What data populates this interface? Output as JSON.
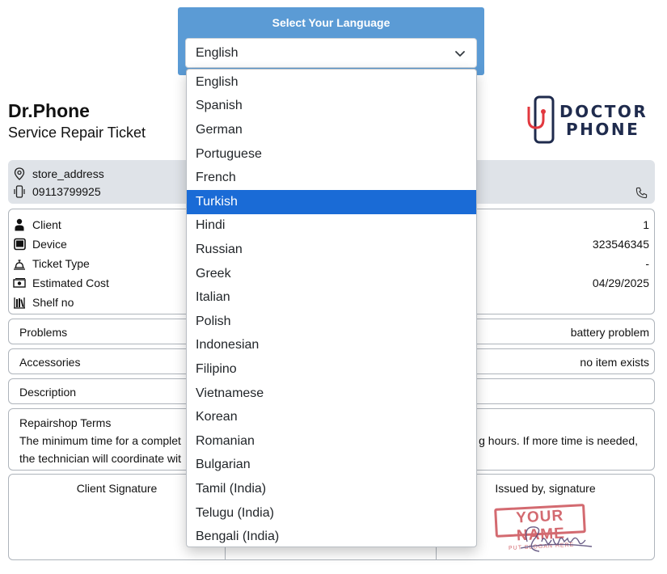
{
  "language": {
    "title": "Select Your Language",
    "selected": "English",
    "options": [
      "English",
      "Spanish",
      "German",
      "Portuguese",
      "French",
      "Turkish",
      "Hindi",
      "Russian",
      "Greek",
      "Italian",
      "Polish",
      "Indonesian",
      "Filipino",
      "Vietnamese",
      "Korean",
      "Romanian",
      "Bulgarian",
      "Tamil (India)",
      "Telugu (India)",
      "Bengali (India)"
    ],
    "highlighted": "Turkish"
  },
  "company": {
    "name": "Dr.Phone",
    "subtitle": "Service Repair Ticket",
    "logo_line1": "DOCTOR",
    "logo_line2": "PHONE"
  },
  "store": {
    "address": "store_address",
    "phone": "09113799925"
  },
  "info": {
    "rows": [
      {
        "label": "Client",
        "icon": "person-icon",
        "value": "1"
      },
      {
        "label": "Device",
        "icon": "tablet-icon",
        "value": "323546345"
      },
      {
        "label": "Ticket Type",
        "icon": "bell-icon",
        "value": "-"
      },
      {
        "label": "Estimated Cost",
        "icon": "cash-icon",
        "value": "04/29/2025"
      },
      {
        "label": "Shelf no",
        "icon": "shelf-icon",
        "value": ""
      }
    ]
  },
  "problems": {
    "label": "Problems",
    "value": "battery problem"
  },
  "accessories": {
    "label": "Accessories",
    "value": "no item exists"
  },
  "description": {
    "label": "Description",
    "value": ""
  },
  "terms": {
    "title": "Repairshop Terms",
    "line1_start": "The minimum time for a complet",
    "line1_end": "g hours. If more time is needed,",
    "line2_start": "the technician will coordinate wit"
  },
  "signature": {
    "client": "Client Signature",
    "issued": "Issued by, signature",
    "stamp_big": "YOUR NAME",
    "stamp_small": "PUT SLOGAN HERE"
  },
  "colors": {
    "panel": "#5b9bd5",
    "highlight": "#1a6bd6",
    "store_bg": "#dfe3e8",
    "logo_accent": "#e2383f",
    "logo_dark": "#1f2b4d"
  }
}
